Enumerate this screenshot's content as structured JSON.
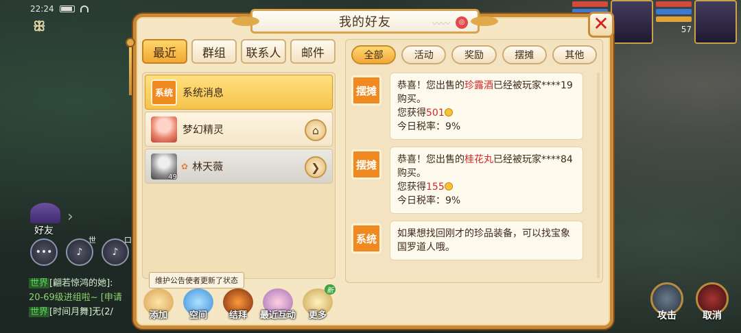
{
  "status_bar": {
    "time": "22:24"
  },
  "background": {
    "friend_label": "好友",
    "round_buttons": [
      "世",
      "口"
    ],
    "chat": [
      {
        "channel": "世界",
        "text": "[翩若惊鸿的她]:"
      },
      {
        "channel": "",
        "text": "20-69级进组啦~ [申请"
      },
      {
        "channel": "世界",
        "text": "[时间月舞]无(2/"
      }
    ],
    "player_level": "57",
    "actions": {
      "attack": "攻击",
      "cancel": "取消"
    }
  },
  "dialog": {
    "title": "我的好友",
    "close_symbol": "✕",
    "tabs": [
      {
        "label": "最近",
        "active": true
      },
      {
        "label": "群组",
        "active": false
      },
      {
        "label": "联系人",
        "active": false
      },
      {
        "label": "邮件",
        "active": false
      }
    ],
    "contacts": [
      {
        "name": "系统消息",
        "avatar_text": "系统"
      },
      {
        "name": "梦幻精灵"
      },
      {
        "name": "林天薇",
        "level": "49"
      }
    ],
    "status_tip": "维护公告使者更新了状态",
    "tools": [
      {
        "label": "添加"
      },
      {
        "label": "空间"
      },
      {
        "label": "结拜"
      },
      {
        "label": "最近互动"
      },
      {
        "label": "更多",
        "badge": "新"
      }
    ],
    "filters": [
      {
        "label": "全部",
        "active": true
      },
      {
        "label": "活动",
        "active": false
      },
      {
        "label": "奖励",
        "active": false
      },
      {
        "label": "摆摊",
        "active": false
      },
      {
        "label": "其他",
        "active": false
      }
    ],
    "messages": [
      {
        "badge": "摆摊",
        "pre": "恭喜！您出售的",
        "item": "珍露酒",
        "post": "已经被玩家****19购买。",
        "earn_label": "您获得",
        "earn_value": "501",
        "tax": "今日税率：9%"
      },
      {
        "badge": "摆摊",
        "pre": "恭喜！您出售的",
        "item": "桂花丸",
        "post": "已经被玩家****84购买。",
        "earn_label": "您获得",
        "earn_value": "155",
        "tax": "今日税率：9%"
      },
      {
        "badge": "系统",
        "text": "如果想找回刚才的珍品装备，可以找宝象国罗道人哦。"
      }
    ]
  },
  "colors": {
    "accent_orange": "#f08a20",
    "highlight_red": "#d22626",
    "frame": "#c98a3a"
  }
}
